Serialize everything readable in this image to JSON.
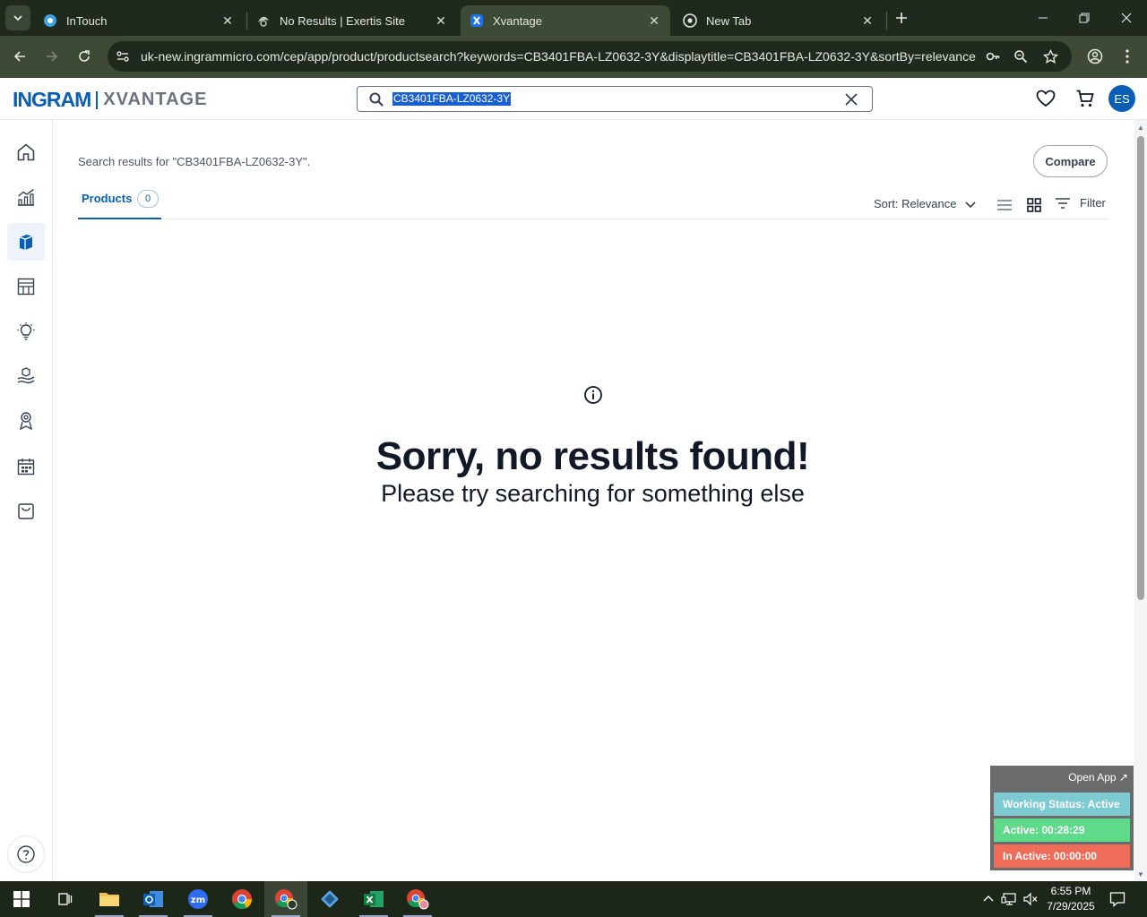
{
  "browser": {
    "tabs": [
      {
        "title": "InTouch",
        "active": false
      },
      {
        "title": "No Results | Exertis Site",
        "active": false
      },
      {
        "title": "Xvantage",
        "active": true
      },
      {
        "title": "New Tab",
        "active": false
      }
    ],
    "url": "uk-new.ingrammicro.com/cep/app/product/productsearch?keywords=CB3401FBA-LZ0632-3Y&displaytitle=CB3401FBA-LZ0632-3Y&sortBy=relevance"
  },
  "header": {
    "logo_primary": "INGRAM",
    "logo_secondary": "XVANTAGE",
    "search_value": "CB3401FBA-LZ0632-3Y",
    "avatar_initials": "ES",
    "brand_color": "#0a5fb4"
  },
  "sidebar": {
    "items": [
      {
        "icon": "home-icon",
        "active": false
      },
      {
        "icon": "analytics-icon",
        "active": false
      },
      {
        "icon": "products-icon",
        "active": true
      },
      {
        "icon": "store-icon",
        "active": false
      },
      {
        "icon": "lightbulb-icon",
        "active": false
      },
      {
        "icon": "services-icon",
        "active": false
      },
      {
        "icon": "support-icon",
        "active": false
      },
      {
        "icon": "calendar-icon",
        "active": false
      },
      {
        "icon": "shopping-bag-icon",
        "active": false
      }
    ]
  },
  "main": {
    "results_text": "Search results for \"CB3401FBA-LZ0632-3Y\".",
    "compare_label": "Compare",
    "products_tab_label": "Products",
    "products_count": "0",
    "sort_label": "Sort: Relevance",
    "filter_label": "Filter",
    "empty_title": "Sorry, no results found!",
    "empty_subtitle": "Please try searching for something else"
  },
  "widget": {
    "open_app": "Open App ↗",
    "working_status": "Working Status: Active",
    "active_time": "Active: 00:28:29",
    "inactive_time": "In Active: 00:00:00",
    "status_color": "#7ecad3",
    "active_color": "#5fd98a",
    "inactive_color": "#ef6b5a"
  },
  "taskbar": {
    "time": "6:55 PM",
    "date": "7/29/2025"
  }
}
